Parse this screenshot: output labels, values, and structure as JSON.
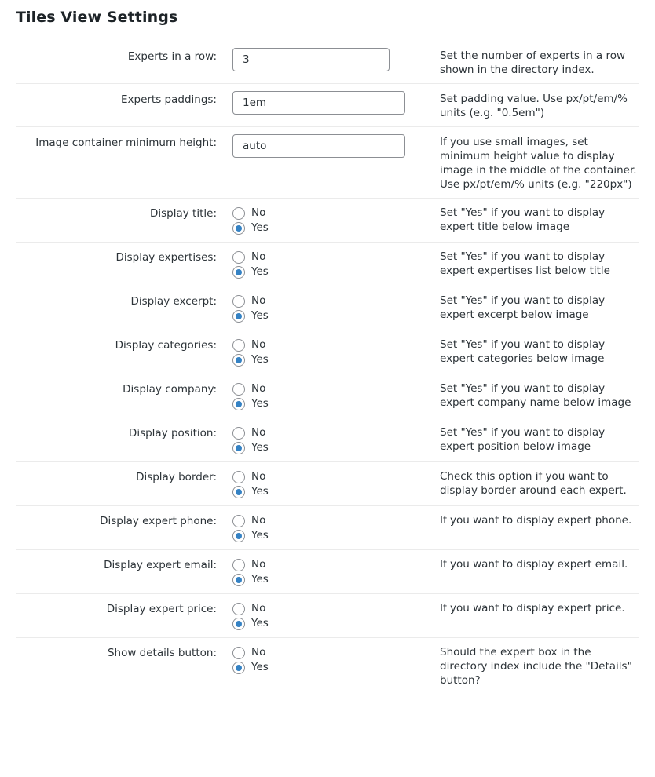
{
  "section_title": "Tiles View Settings",
  "text_settings": [
    {
      "label": "Experts in a row:",
      "value": "3",
      "description": "Set the number of experts in a row shown in the directory index."
    },
    {
      "label": "Experts paddings:",
      "value": "1em",
      "description": "Set padding value. Use px/pt/em/% units (e.g. \"0.5em\")"
    },
    {
      "label": "Image container minimum height:",
      "value": "auto",
      "description": "If you use small images, set minimum height value to display image in the middle of the container. Use px/pt/em/% units (e.g. \"220px\")"
    }
  ],
  "radio_options": {
    "no": "No",
    "yes": "Yes"
  },
  "radio_settings": [
    {
      "label": "Display title:",
      "selected": "Yes",
      "description": "Set \"Yes\" if you want to display expert title below image"
    },
    {
      "label": "Display expertises:",
      "selected": "Yes",
      "description": "Set \"Yes\" if you want to display expert expertises list below title"
    },
    {
      "label": "Display excerpt:",
      "selected": "Yes",
      "description": "Set \"Yes\" if you want to display expert excerpt below image"
    },
    {
      "label": "Display categories:",
      "selected": "Yes",
      "description": "Set \"Yes\" if you want to display expert categories below image"
    },
    {
      "label": "Display company:",
      "selected": "Yes",
      "description": "Set \"Yes\" if you want to display expert company name below image"
    },
    {
      "label": "Display position:",
      "selected": "Yes",
      "description": "Set \"Yes\" if you want to display expert position below image"
    },
    {
      "label": "Display border:",
      "selected": "Yes",
      "description": "Check this option if you want to display border around each expert."
    },
    {
      "label": "Display expert phone:",
      "selected": "Yes",
      "description": "If you want to display expert phone."
    },
    {
      "label": "Display expert email:",
      "selected": "Yes",
      "description": "If you want to display expert email."
    },
    {
      "label": "Display expert price:",
      "selected": "Yes",
      "description": "If you want to display expert price."
    },
    {
      "label": "Show details button:",
      "selected": "Yes",
      "description": "Should the expert box in the directory index include the \"Details\" button?"
    }
  ],
  "colors": {
    "accent": "#3582c4",
    "text": "#2c3338",
    "divider": "#ebebeb"
  }
}
